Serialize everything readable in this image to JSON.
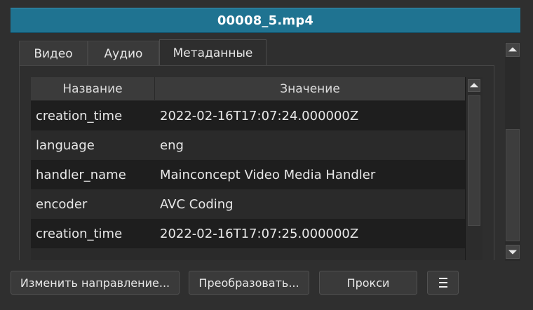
{
  "window": {
    "title": "00008_5.mp4"
  },
  "tabs": [
    {
      "label": "Видео",
      "active": false
    },
    {
      "label": "Аудио",
      "active": false
    },
    {
      "label": "Метаданные",
      "active": true
    }
  ],
  "table": {
    "headers": [
      "Название",
      "Значение"
    ],
    "rows": [
      {
        "name": "creation_time",
        "value": "2022-02-16T17:07:24.000000Z"
      },
      {
        "name": "language",
        "value": "eng"
      },
      {
        "name": "handler_name",
        "value": "Mainconcept Video Media Handler"
      },
      {
        "name": "encoder",
        "value": "AVC Coding"
      },
      {
        "name": "creation_time",
        "value": "2022-02-16T17:07:25.000000Z"
      }
    ]
  },
  "buttons": {
    "rotate": "Изменить направление...",
    "convert": "Преобразовать...",
    "proxy": "Прокси",
    "menu_icon": "hamburger-menu-icon"
  },
  "colors": {
    "title_bar": "#1f7391",
    "background": "#2f2f2f",
    "table_row_dark": "#1e1e1e",
    "table_row_light": "#2a2a2a"
  }
}
